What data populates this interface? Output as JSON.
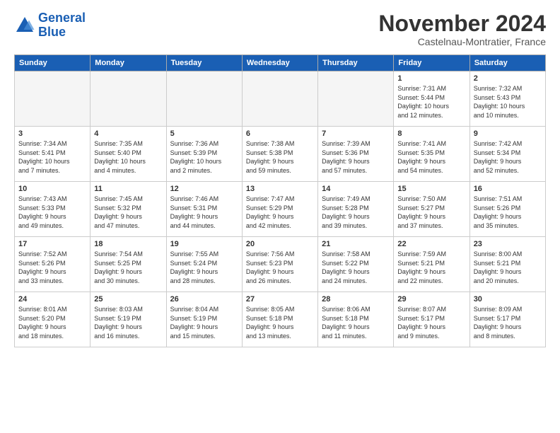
{
  "logo": {
    "text_general": "General",
    "text_blue": "Blue"
  },
  "header": {
    "month_title": "November 2024",
    "location": "Castelnau-Montratier, France"
  },
  "weekdays": [
    "Sunday",
    "Monday",
    "Tuesday",
    "Wednesday",
    "Thursday",
    "Friday",
    "Saturday"
  ],
  "weeks": [
    [
      {
        "day": "",
        "info": "",
        "empty": true
      },
      {
        "day": "",
        "info": "",
        "empty": true
      },
      {
        "day": "",
        "info": "",
        "empty": true
      },
      {
        "day": "",
        "info": "",
        "empty": true
      },
      {
        "day": "",
        "info": "",
        "empty": true
      },
      {
        "day": "1",
        "info": "Sunrise: 7:31 AM\nSunset: 5:44 PM\nDaylight: 10 hours\nand 12 minutes."
      },
      {
        "day": "2",
        "info": "Sunrise: 7:32 AM\nSunset: 5:43 PM\nDaylight: 10 hours\nand 10 minutes."
      }
    ],
    [
      {
        "day": "3",
        "info": "Sunrise: 7:34 AM\nSunset: 5:41 PM\nDaylight: 10 hours\nand 7 minutes."
      },
      {
        "day": "4",
        "info": "Sunrise: 7:35 AM\nSunset: 5:40 PM\nDaylight: 10 hours\nand 4 minutes."
      },
      {
        "day": "5",
        "info": "Sunrise: 7:36 AM\nSunset: 5:39 PM\nDaylight: 10 hours\nand 2 minutes."
      },
      {
        "day": "6",
        "info": "Sunrise: 7:38 AM\nSunset: 5:38 PM\nDaylight: 9 hours\nand 59 minutes."
      },
      {
        "day": "7",
        "info": "Sunrise: 7:39 AM\nSunset: 5:36 PM\nDaylight: 9 hours\nand 57 minutes."
      },
      {
        "day": "8",
        "info": "Sunrise: 7:41 AM\nSunset: 5:35 PM\nDaylight: 9 hours\nand 54 minutes."
      },
      {
        "day": "9",
        "info": "Sunrise: 7:42 AM\nSunset: 5:34 PM\nDaylight: 9 hours\nand 52 minutes."
      }
    ],
    [
      {
        "day": "10",
        "info": "Sunrise: 7:43 AM\nSunset: 5:33 PM\nDaylight: 9 hours\nand 49 minutes."
      },
      {
        "day": "11",
        "info": "Sunrise: 7:45 AM\nSunset: 5:32 PM\nDaylight: 9 hours\nand 47 minutes."
      },
      {
        "day": "12",
        "info": "Sunrise: 7:46 AM\nSunset: 5:31 PM\nDaylight: 9 hours\nand 44 minutes."
      },
      {
        "day": "13",
        "info": "Sunrise: 7:47 AM\nSunset: 5:29 PM\nDaylight: 9 hours\nand 42 minutes."
      },
      {
        "day": "14",
        "info": "Sunrise: 7:49 AM\nSunset: 5:28 PM\nDaylight: 9 hours\nand 39 minutes."
      },
      {
        "day": "15",
        "info": "Sunrise: 7:50 AM\nSunset: 5:27 PM\nDaylight: 9 hours\nand 37 minutes."
      },
      {
        "day": "16",
        "info": "Sunrise: 7:51 AM\nSunset: 5:26 PM\nDaylight: 9 hours\nand 35 minutes."
      }
    ],
    [
      {
        "day": "17",
        "info": "Sunrise: 7:52 AM\nSunset: 5:26 PM\nDaylight: 9 hours\nand 33 minutes."
      },
      {
        "day": "18",
        "info": "Sunrise: 7:54 AM\nSunset: 5:25 PM\nDaylight: 9 hours\nand 30 minutes."
      },
      {
        "day": "19",
        "info": "Sunrise: 7:55 AM\nSunset: 5:24 PM\nDaylight: 9 hours\nand 28 minutes."
      },
      {
        "day": "20",
        "info": "Sunrise: 7:56 AM\nSunset: 5:23 PM\nDaylight: 9 hours\nand 26 minutes."
      },
      {
        "day": "21",
        "info": "Sunrise: 7:58 AM\nSunset: 5:22 PM\nDaylight: 9 hours\nand 24 minutes."
      },
      {
        "day": "22",
        "info": "Sunrise: 7:59 AM\nSunset: 5:21 PM\nDaylight: 9 hours\nand 22 minutes."
      },
      {
        "day": "23",
        "info": "Sunrise: 8:00 AM\nSunset: 5:21 PM\nDaylight: 9 hours\nand 20 minutes."
      }
    ],
    [
      {
        "day": "24",
        "info": "Sunrise: 8:01 AM\nSunset: 5:20 PM\nDaylight: 9 hours\nand 18 minutes."
      },
      {
        "day": "25",
        "info": "Sunrise: 8:03 AM\nSunset: 5:19 PM\nDaylight: 9 hours\nand 16 minutes."
      },
      {
        "day": "26",
        "info": "Sunrise: 8:04 AM\nSunset: 5:19 PM\nDaylight: 9 hours\nand 15 minutes."
      },
      {
        "day": "27",
        "info": "Sunrise: 8:05 AM\nSunset: 5:18 PM\nDaylight: 9 hours\nand 13 minutes."
      },
      {
        "day": "28",
        "info": "Sunrise: 8:06 AM\nSunset: 5:18 PM\nDaylight: 9 hours\nand 11 minutes."
      },
      {
        "day": "29",
        "info": "Sunrise: 8:07 AM\nSunset: 5:17 PM\nDaylight: 9 hours\nand 9 minutes."
      },
      {
        "day": "30",
        "info": "Sunrise: 8:09 AM\nSunset: 5:17 PM\nDaylight: 9 hours\nand 8 minutes."
      }
    ]
  ]
}
